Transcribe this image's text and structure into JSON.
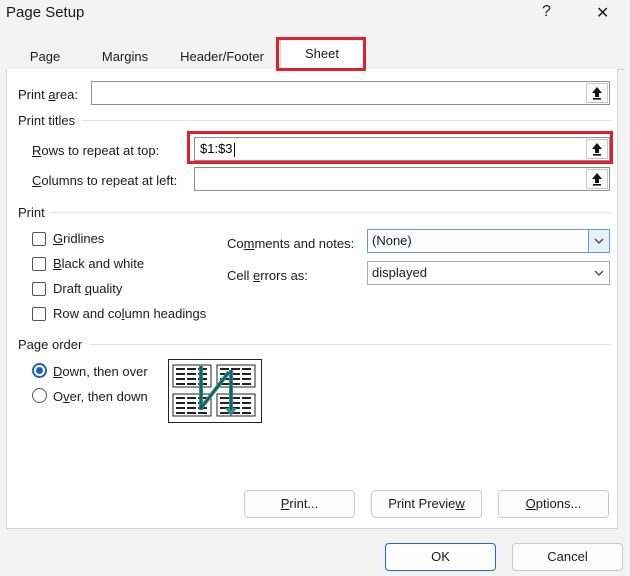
{
  "window": {
    "title": "Page Setup",
    "help_label": "?",
    "close_label": "✕"
  },
  "tabs": [
    {
      "label": "Page"
    },
    {
      "label": "Margins"
    },
    {
      "label": "Header/Footer"
    },
    {
      "label": "Sheet",
      "active": true
    }
  ],
  "print_area": {
    "label_pre": "Print ",
    "label_ul": "a",
    "label_post": "rea:",
    "value": ""
  },
  "print_titles": {
    "heading": "Print titles",
    "rows": {
      "label_ul": "R",
      "label_post": "ows to repeat at top:",
      "value": "$1:$3"
    },
    "columns": {
      "label_ul": "C",
      "label_post": "olumns to repeat at left:",
      "value": ""
    }
  },
  "print": {
    "heading": "Print",
    "options": [
      {
        "ul": "G",
        "rest": "ridlines",
        "checked": false
      },
      {
        "ul": "B",
        "rest": "lack and white",
        "checked": false
      },
      {
        "pre": "Draft ",
        "ul": "q",
        "rest": "uality",
        "checked": false
      },
      {
        "pre": "Row and co",
        "ul": "l",
        "rest": "umn headings",
        "checked": false
      }
    ],
    "comments": {
      "pre": "Co",
      "ul": "m",
      "rest": "ments and notes:",
      "value": "(None)"
    },
    "cell_errors": {
      "pre": "Cell ",
      "ul": "e",
      "rest": "rrors as:",
      "value": "displayed"
    }
  },
  "page_order": {
    "heading": "Page order",
    "options": [
      {
        "ul": "D",
        "rest": "own, then over",
        "selected": true
      },
      {
        "pre": "O",
        "ul": "v",
        "rest": "er, then down",
        "selected": false
      }
    ]
  },
  "buttons": {
    "print": {
      "pre": "",
      "ul": "P",
      "rest": "rint..."
    },
    "preview": {
      "pre": "Print Previe",
      "ul": "w",
      "rest": ""
    },
    "options": {
      "pre": "",
      "ul": "O",
      "rest": "ptions..."
    },
    "ok": "OK",
    "cancel": "Cancel"
  },
  "colors": {
    "highlight": "#e0202d",
    "accent": "#1f5fbf",
    "arrow": "#2a8c8c"
  }
}
